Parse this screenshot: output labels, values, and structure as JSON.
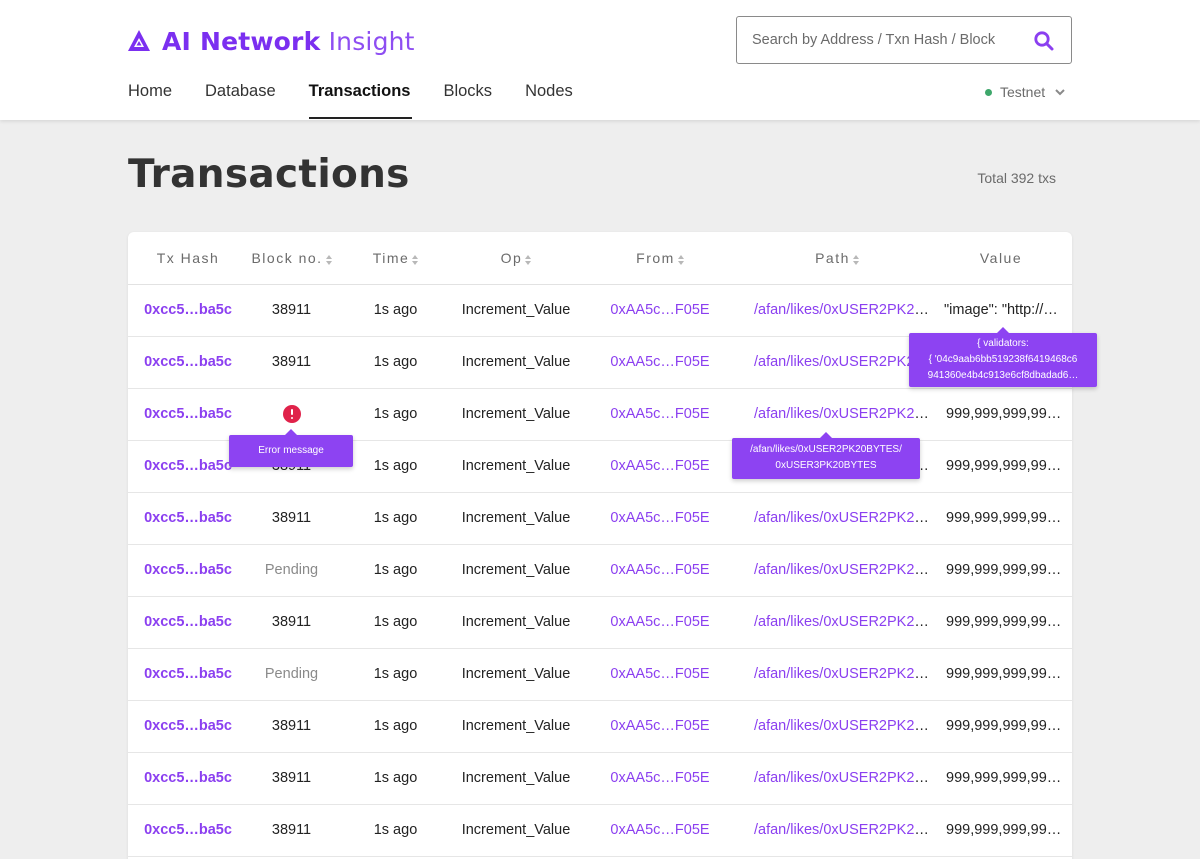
{
  "app": {
    "logo_bold": "AI Network",
    "logo_light": "Insight",
    "brand_color": "#7b2ff0"
  },
  "search": {
    "placeholder": "Search by Address / Txn Hash / Block",
    "icon": "search-icon"
  },
  "nav": {
    "items": [
      "Home",
      "Database",
      "Transactions",
      "Blocks",
      "Nodes"
    ],
    "active": "Transactions"
  },
  "network": {
    "label": "Testnet",
    "status_color": "#3ea76b"
  },
  "page": {
    "title": "Transactions",
    "total": "Total 392 txs"
  },
  "table": {
    "columns": [
      "Tx Hash",
      "Block no.",
      "Time",
      "Op",
      "From",
      "Path",
      "Value"
    ],
    "sortable": [
      false,
      true,
      true,
      true,
      true,
      true,
      false
    ],
    "rows": [
      {
        "hash": "0xcc5…ba5c",
        "block": "38911",
        "time": "1s ago",
        "op": "Increment_Value",
        "from": "0xAA5c…F05E",
        "path": "/afan/likes/0xUSER2PK20…",
        "value": "\"image\": \"http://a…"
      },
      {
        "hash": "0xcc5…ba5c",
        "block": "38911",
        "time": "1s ago",
        "op": "Increment_Value",
        "from": "0xAA5c…F05E",
        "path": "/afan/likes/0xUSER2PK20…",
        "value": "999,999,999,993,…"
      },
      {
        "hash": "0xcc5…ba5c",
        "block": "",
        "block_status": "error",
        "time": "1s ago",
        "op": "Increment_Value",
        "from": "0xAA5c…F05E",
        "path": "/afan/likes/0xUSER2PK20…",
        "value": "999,999,999,993,…"
      },
      {
        "hash": "0xcc5…ba5c",
        "block": "38911",
        "time": "1s ago",
        "op": "Increment_Value",
        "from": "0xAA5c…F05E",
        "path": "/afan/likes/0xUSER2PK20…",
        "value": "999,999,999,993,…"
      },
      {
        "hash": "0xcc5…ba5c",
        "block": "38911",
        "time": "1s ago",
        "op": "Increment_Value",
        "from": "0xAA5c…F05E",
        "path": "/afan/likes/0xUSER2PK20…",
        "value": "999,999,999,993,…"
      },
      {
        "hash": "0xcc5…ba5c",
        "block": "Pending",
        "block_status": "pending",
        "time": "1s ago",
        "op": "Increment_Value",
        "from": "0xAA5c…F05E",
        "path": "/afan/likes/0xUSER2PK20…",
        "value": "999,999,999,993,…"
      },
      {
        "hash": "0xcc5…ba5c",
        "block": "38911",
        "time": "1s ago",
        "op": "Increment_Value",
        "from": "0xAA5c…F05E",
        "path": "/afan/likes/0xUSER2PK20…",
        "value": "999,999,999,993,…"
      },
      {
        "hash": "0xcc5…ba5c",
        "block": "Pending",
        "block_status": "pending",
        "time": "1s ago",
        "op": "Increment_Value",
        "from": "0xAA5c…F05E",
        "path": "/afan/likes/0xUSER2PK20…",
        "value": "999,999,999,993,…"
      },
      {
        "hash": "0xcc5…ba5c",
        "block": "38911",
        "time": "1s ago",
        "op": "Increment_Value",
        "from": "0xAA5c…F05E",
        "path": "/afan/likes/0xUSER2PK20…",
        "value": "999,999,999,993,…"
      },
      {
        "hash": "0xcc5…ba5c",
        "block": "38911",
        "time": "1s ago",
        "op": "Increment_Value",
        "from": "0xAA5c…F05E",
        "path": "/afan/likes/0xUSER2PK20…",
        "value": "999,999,999,993,…"
      },
      {
        "hash": "0xcc5…ba5c",
        "block": "38911",
        "time": "1s ago",
        "op": "Increment_Value",
        "from": "0xAA5c…F05E",
        "path": "/afan/likes/0xUSER2PK20…",
        "value": "999,999,999,993,…"
      }
    ]
  },
  "tooltips": {
    "error": "Error message",
    "path_line1": "/afan/likes/0xUSER2PK20BYTES/",
    "path_line2": "0xUSER3PK20BYTES",
    "value_line1": "{ validators:",
    "value_line2": "{ '04c9aab6bb519238f6419468c6",
    "value_line3": "941360e4b4c913e6cf8dbadad6…"
  },
  "colors": {
    "error": "#e0224a",
    "tooltip": "#8d43f2",
    "link": "#8b3ff0"
  }
}
